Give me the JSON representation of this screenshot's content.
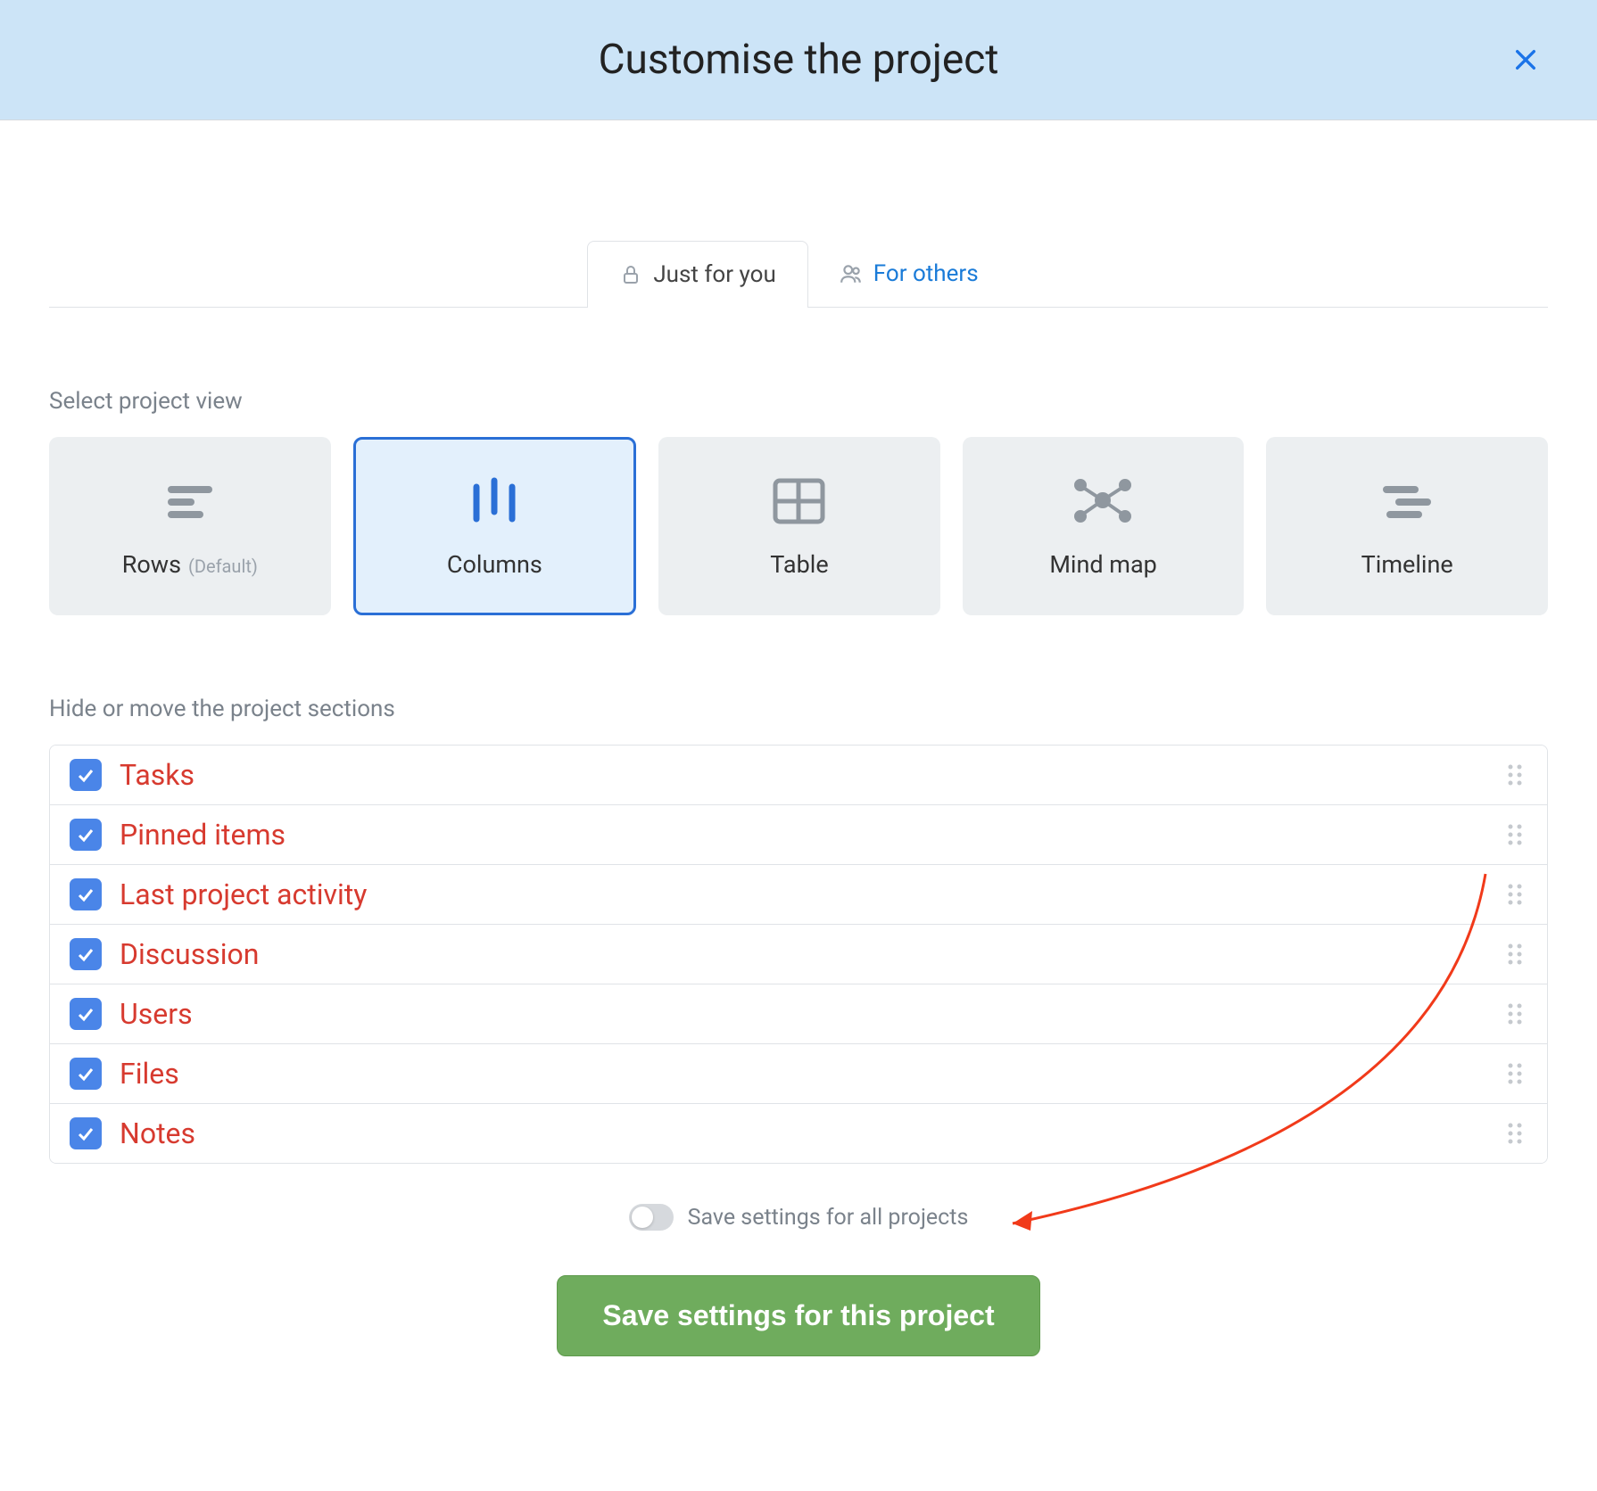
{
  "header": {
    "title": "Customise the project"
  },
  "tabs": {
    "just_for_you": "Just for you",
    "for_others": "For others"
  },
  "view_section": {
    "label": "Select project view",
    "cards": {
      "rows": {
        "label": "Rows",
        "default_suffix": "(Default)"
      },
      "columns": {
        "label": "Columns"
      },
      "table": {
        "label": "Table"
      },
      "mindmap": {
        "label": "Mind map"
      },
      "timeline": {
        "label": "Timeline"
      }
    }
  },
  "sections_section": {
    "label": "Hide or move the project sections",
    "items": [
      {
        "label": "Tasks",
        "checked": true
      },
      {
        "label": "Pinned items",
        "checked": true
      },
      {
        "label": "Last project activity",
        "checked": true
      },
      {
        "label": "Discussion",
        "checked": true
      },
      {
        "label": "Users",
        "checked": true
      },
      {
        "label": "Files",
        "checked": true
      },
      {
        "label": "Notes",
        "checked": true
      }
    ]
  },
  "toggle": {
    "label": "Save settings for all projects",
    "on": false
  },
  "save_button": {
    "label": "Save settings for this project"
  }
}
